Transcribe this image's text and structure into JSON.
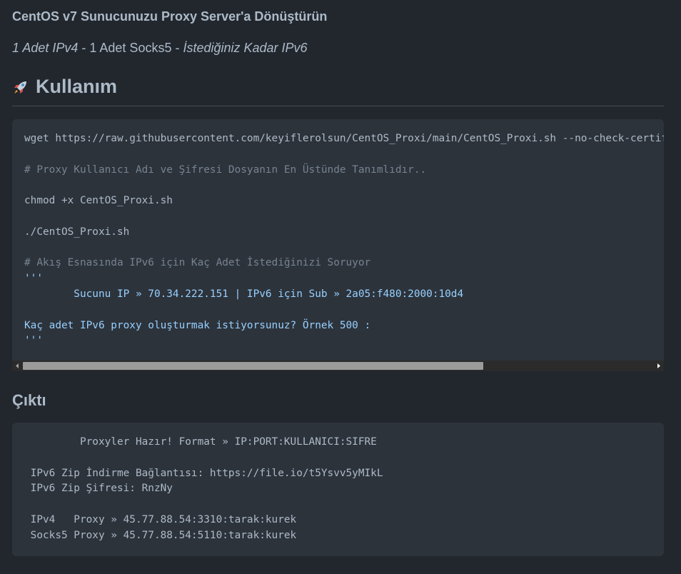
{
  "title": "CentOS v7 Sunucunuzu Proxy Server'a Dönüştürün",
  "subtitle": {
    "part1": "1 Adet IPv4",
    "part2": " - 1 Adet Socks5 - ",
    "part3": "İstediğiniz Kadar IPv6"
  },
  "usage": {
    "heading": "Kullanım",
    "icon": "rocket-icon",
    "code_lines": [
      "wget https://raw.githubusercontent.com/keyiflerolsun/CentOS_Proxi/main/CentOS_Proxi.sh --no-check-certificate",
      "# Proxy Kullanıcı Adı ve Şifresi Dosyanın En Üstünde Tanımlıdır..",
      "chmod +x CentOS_Proxi.sh",
      "./CentOS_Proxi.sh",
      "# Akış Esnasında IPv6 için Kaç Adet İstediğinizi Soruyor",
      "'''",
      "        Sucunu IP » 70.34.222.151 | IPv6 için Sub » 2a05:f480:2000:10d4",
      "Kaç adet IPv6 proxy oluşturmak istiyorsunuz? Örnek 500 :",
      "'''"
    ],
    "scroll_position": 0.73
  },
  "output": {
    "heading": "Çıktı",
    "code_lines": [
      "         Proxyler Hazır! Format » IP:PORT:KULLANICI:SIFRE",
      " IPv6 Zip İndirme Bağlantısı: https://file.io/t5Ysvv5yMIkL",
      " IPv6 Zip Şifresi: RnzNy",
      " IPv4   Proxy » 45.77.88.54:3310:tarak:kurek",
      " Socks5 Proxy » 45.77.88.54:5110:tarak:kurek"
    ]
  },
  "colors": {
    "background": "#22272e",
    "code_background": "#2d333b",
    "text": "#adbac7",
    "comment": "#768390",
    "string": "#96d0ff"
  }
}
